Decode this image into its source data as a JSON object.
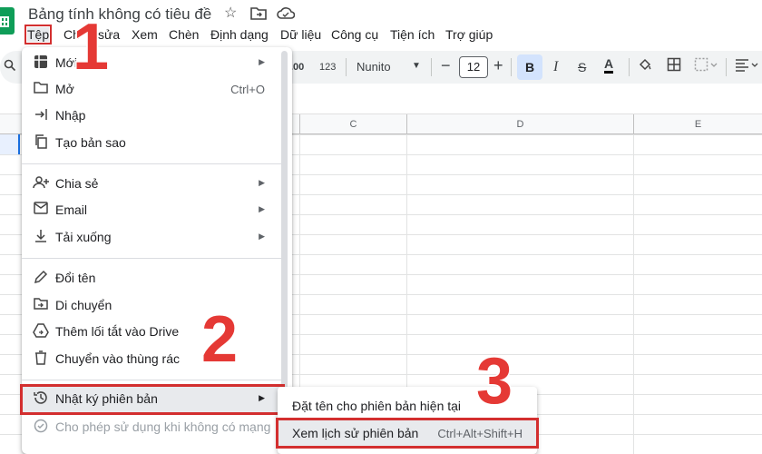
{
  "app": {
    "title": "Bảng tính không có tiêu đề",
    "star_icon": "star-icon",
    "move_icon": "folder-move-icon",
    "cloud_icon": "cloud-status-icon"
  },
  "menubar": [
    "Tệp",
    "Chỉnh sửa",
    "Xem",
    "Chèn",
    "Định dạng",
    "Dữ liệu",
    "Công cụ",
    "Tiện ích",
    "Trợ giúp"
  ],
  "menubar_visible": [
    "Tệp",
    "Ch",
    "sửa",
    "Xem",
    "Chèn",
    "Định dạng",
    "Dữ liệu",
    "Công cụ",
    "Tiện ích",
    "Trợ giúp"
  ],
  "toolbar": {
    "decimal_label": ".00",
    "number_format_label": "123",
    "font_name": "Nunito",
    "font_size": "12",
    "minus": "−",
    "plus": "+",
    "bold": "B",
    "italic": "I",
    "strike": "S",
    "text_color": "A"
  },
  "columns": [
    "C",
    "D",
    "E"
  ],
  "file_menu": {
    "items": [
      {
        "label": "Mới",
        "icon": "new-sheet-icon",
        "submenu": true
      },
      {
        "label": "Mở",
        "icon": "folder-open-icon",
        "shortcut": "Ctrl+O"
      },
      {
        "label": "Nhập",
        "icon": "import-icon"
      },
      {
        "label": "Tạo bản sao",
        "icon": "copy-icon"
      },
      {
        "label": "Chia sẻ",
        "icon": "share-person-icon",
        "submenu": true
      },
      {
        "label": "Email",
        "icon": "email-icon",
        "submenu": true
      },
      {
        "label": "Tải xuống",
        "icon": "download-icon",
        "submenu": true
      },
      {
        "label": "Đổi tên",
        "icon": "pencil-icon"
      },
      {
        "label": "Di chuyển",
        "icon": "folder-move-icon"
      },
      {
        "label": "Thêm lối tắt vào Drive",
        "icon": "drive-shortcut-icon"
      },
      {
        "label": "Chuyển vào thùng rác",
        "icon": "trash-icon"
      },
      {
        "label": "Nhật ký phiên bản",
        "icon": "history-icon",
        "submenu": true
      },
      {
        "label": "Cho phép sử dụng khi không có mạng",
        "icon": "offline-icon",
        "disabled": true
      }
    ]
  },
  "version_submenu": {
    "items": [
      {
        "label": "Đặt tên cho phiên bản hiện tại"
      },
      {
        "label": "Xem lịch sử phiên bản",
        "shortcut": "Ctrl+Alt+Shift+H"
      }
    ]
  },
  "steps": [
    "1",
    "2",
    "3"
  ],
  "colors": {
    "annotation_red": "#d32f2f",
    "sheets_green": "#0f9d58",
    "bold_active": "#d3e3fd"
  }
}
